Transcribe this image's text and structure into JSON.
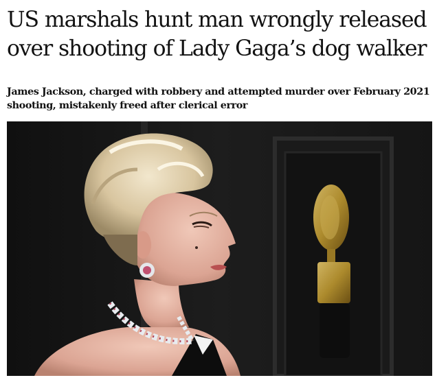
{
  "article": {
    "headline": "US marshals hunt man wrongly released over shooting of Lady Gaga’s dog walker",
    "standfirst": "James Jackson, charged with robbery and attempted murder over February 2021 shooting, mistakenly freed after clerical error"
  },
  "image": {
    "subject": "Lady Gaga at awards ceremony with gramophone trophy backdrop"
  },
  "colors": {
    "text": "#121212",
    "background": "#ffffff",
    "photo_backdrop": "#1b1b1b",
    "trophy_gold": "#c8a032"
  }
}
